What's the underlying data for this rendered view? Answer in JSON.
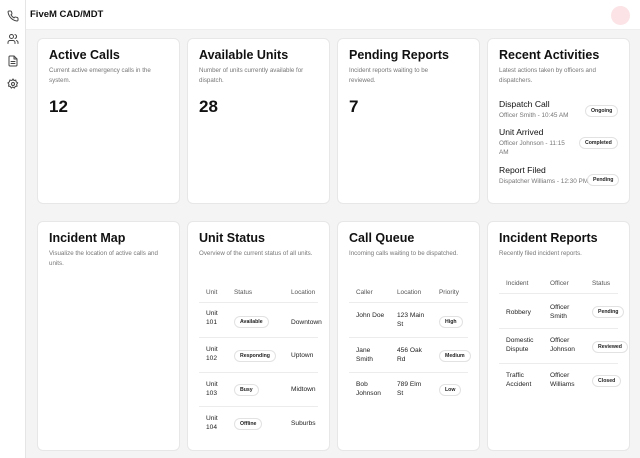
{
  "app": {
    "title": "FiveM CAD/MDT"
  },
  "sidebar": {
    "icons": [
      "phone-icon",
      "users-icon",
      "document-icon",
      "settings-icon"
    ]
  },
  "cards": {
    "active_calls": {
      "title": "Active Calls",
      "description": "Current active emergency calls in the system.",
      "value": "12"
    },
    "available_units": {
      "title": "Available Units",
      "description": "Number of units currently available for dispatch.",
      "value": "28"
    },
    "pending_reports": {
      "title": "Pending Reports",
      "description": "Incident reports waiting to be reviewed.",
      "value": "7"
    },
    "recent_activities": {
      "title": "Recent Activities",
      "description": "Latest actions taken by officers and dispatchers.",
      "items": [
        {
          "title": "Dispatch Call",
          "subtitle": "Officer Smith - 10:45 AM",
          "status": "Ongoing"
        },
        {
          "title": "Unit Arrived",
          "subtitle": "Officer Johnson - 11:15 AM",
          "status": "Completed"
        },
        {
          "title": "Report Filed",
          "subtitle": "Dispatcher Williams - 12:30 PM",
          "status": "Pending"
        }
      ]
    },
    "incident_map": {
      "title": "Incident Map",
      "description": "Visualize the location of active calls and units."
    },
    "unit_status": {
      "title": "Unit Status",
      "description": "Overview of the current status of all units.",
      "headers": [
        "Unit",
        "Status",
        "Location"
      ],
      "rows": [
        {
          "unit": "Unit 101",
          "status": "Available",
          "location": "Downtown"
        },
        {
          "unit": "Unit 102",
          "status": "Responding",
          "location": "Uptown"
        },
        {
          "unit": "Unit 103",
          "status": "Busy",
          "location": "Midtown"
        },
        {
          "unit": "Unit 104",
          "status": "Offline",
          "location": "Suburbs"
        }
      ]
    },
    "call_queue": {
      "title": "Call Queue",
      "description": "Incoming calls waiting to be dispatched.",
      "headers": [
        "Caller",
        "Location",
        "Priority"
      ],
      "rows": [
        {
          "caller": "John Doe",
          "location": "123 Main St",
          "priority": "High"
        },
        {
          "caller": "Jane Smith",
          "location": "456 Oak Rd",
          "priority": "Medium"
        },
        {
          "caller": "Bob Johnson",
          "location": "789 Elm St",
          "priority": "Low"
        }
      ]
    },
    "incident_reports": {
      "title": "Incident Reports",
      "description": "Recently filed incident reports.",
      "headers": [
        "Incident",
        "Officer",
        "Status"
      ],
      "rows": [
        {
          "incident": "Robbery",
          "officer": "Officer Smith",
          "status": "Pending"
        },
        {
          "incident": "Domestic Dispute",
          "officer": "Officer Johnson",
          "status": "Reviewed"
        },
        {
          "incident": "Traffic Accident",
          "officer": "Officer Williams",
          "status": "Closed"
        }
      ]
    }
  }
}
